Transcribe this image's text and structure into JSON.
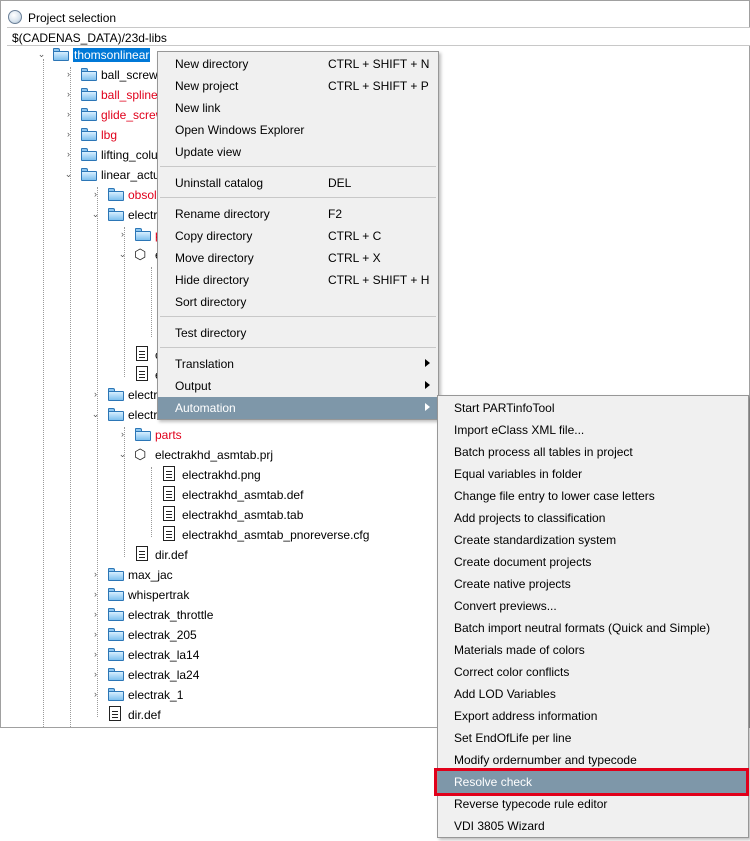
{
  "window": {
    "title": "Project selection",
    "path": "$(CADENAS_DATA)/23d-libs"
  },
  "tree": {
    "root": "thomsonlinear",
    "items": {
      "ball_screws": "ball_screws",
      "ball_splines": "ball_splines",
      "glide_screws": "glide_screw",
      "lbg": "lbg",
      "lifting_columns": "lifting_colu",
      "linear_actuators": "linear_actu",
      "obsolete": "obsol",
      "electrak1": "electr",
      "parts_partial": "p",
      "e_partial": "e",
      "doc_c": "c",
      "doc_e": "e",
      "electr2": "electr",
      "electrakhd": "electr",
      "parts": "parts",
      "electrakhd_asmtab_prj": "electrakhd_asmtab.prj",
      "electrakhd_png": "electrakhd.png",
      "electrakhd_asmtab_def": "electrakhd_asmtab.def",
      "electrakhd_asmtab_tab": "electrakhd_asmtab.tab",
      "electrakhd_asmtab_pnoreverse_cfg": "electrakhd_asmtab_pnoreverse.cfg",
      "dir_def_inner": "dir.def",
      "max_jac": "max_jac",
      "whispertrak": "whispertrak",
      "electrak_throttle": "electrak_throttle",
      "electrak_205": "electrak_205",
      "electrak_la14": "electrak_la14",
      "electrak_la24": "electrak_la24",
      "electrak_1": "electrak_1",
      "dir_def_outer": "dir.def"
    }
  },
  "context_menu": {
    "new_directory": {
      "label": "New directory",
      "shortcut": "CTRL + SHIFT + N"
    },
    "new_project": {
      "label": "New project",
      "shortcut": "CTRL + SHIFT + P"
    },
    "new_link": {
      "label": "New link"
    },
    "open_explorer": {
      "label": "Open Windows Explorer"
    },
    "update_view": {
      "label": "Update view"
    },
    "uninstall_catalog": {
      "label": "Uninstall catalog",
      "shortcut": "DEL"
    },
    "rename_directory": {
      "label": "Rename directory",
      "shortcut": "F2"
    },
    "copy_directory": {
      "label": "Copy directory",
      "shortcut": "CTRL + C"
    },
    "move_directory": {
      "label": "Move directory",
      "shortcut": "CTRL + X"
    },
    "hide_directory": {
      "label": "Hide directory",
      "shortcut": "CTRL + SHIFT + H"
    },
    "sort_directory": {
      "label": "Sort directory"
    },
    "test_directory": {
      "label": "Test directory"
    },
    "translation": {
      "label": "Translation"
    },
    "output": {
      "label": "Output"
    },
    "automation": {
      "label": "Automation"
    }
  },
  "automation_menu": [
    "Start PARTinfoTool",
    "Import eClass XML file...",
    "Batch process all tables in project",
    "Equal variables in folder",
    "Change file entry to lower case letters",
    "Add projects to classification",
    "Create standardization system",
    "Create document projects",
    "Create native projects",
    "Convert previews...",
    "Batch import neutral formats (Quick and Simple)",
    "Materials made of colors",
    "Correct color conflicts",
    "Add LOD Variables",
    "Export address information",
    "Set EndOfLife per line",
    "Modify ordernumber and typecode",
    "Resolve check",
    "Reverse typecode rule editor",
    "VDI 3805 Wizard"
  ],
  "colors": {
    "selection": "#0078d7",
    "menu_highlight": "#7e97a9",
    "red_label": "#e0001b",
    "callout": "#e1001a"
  }
}
